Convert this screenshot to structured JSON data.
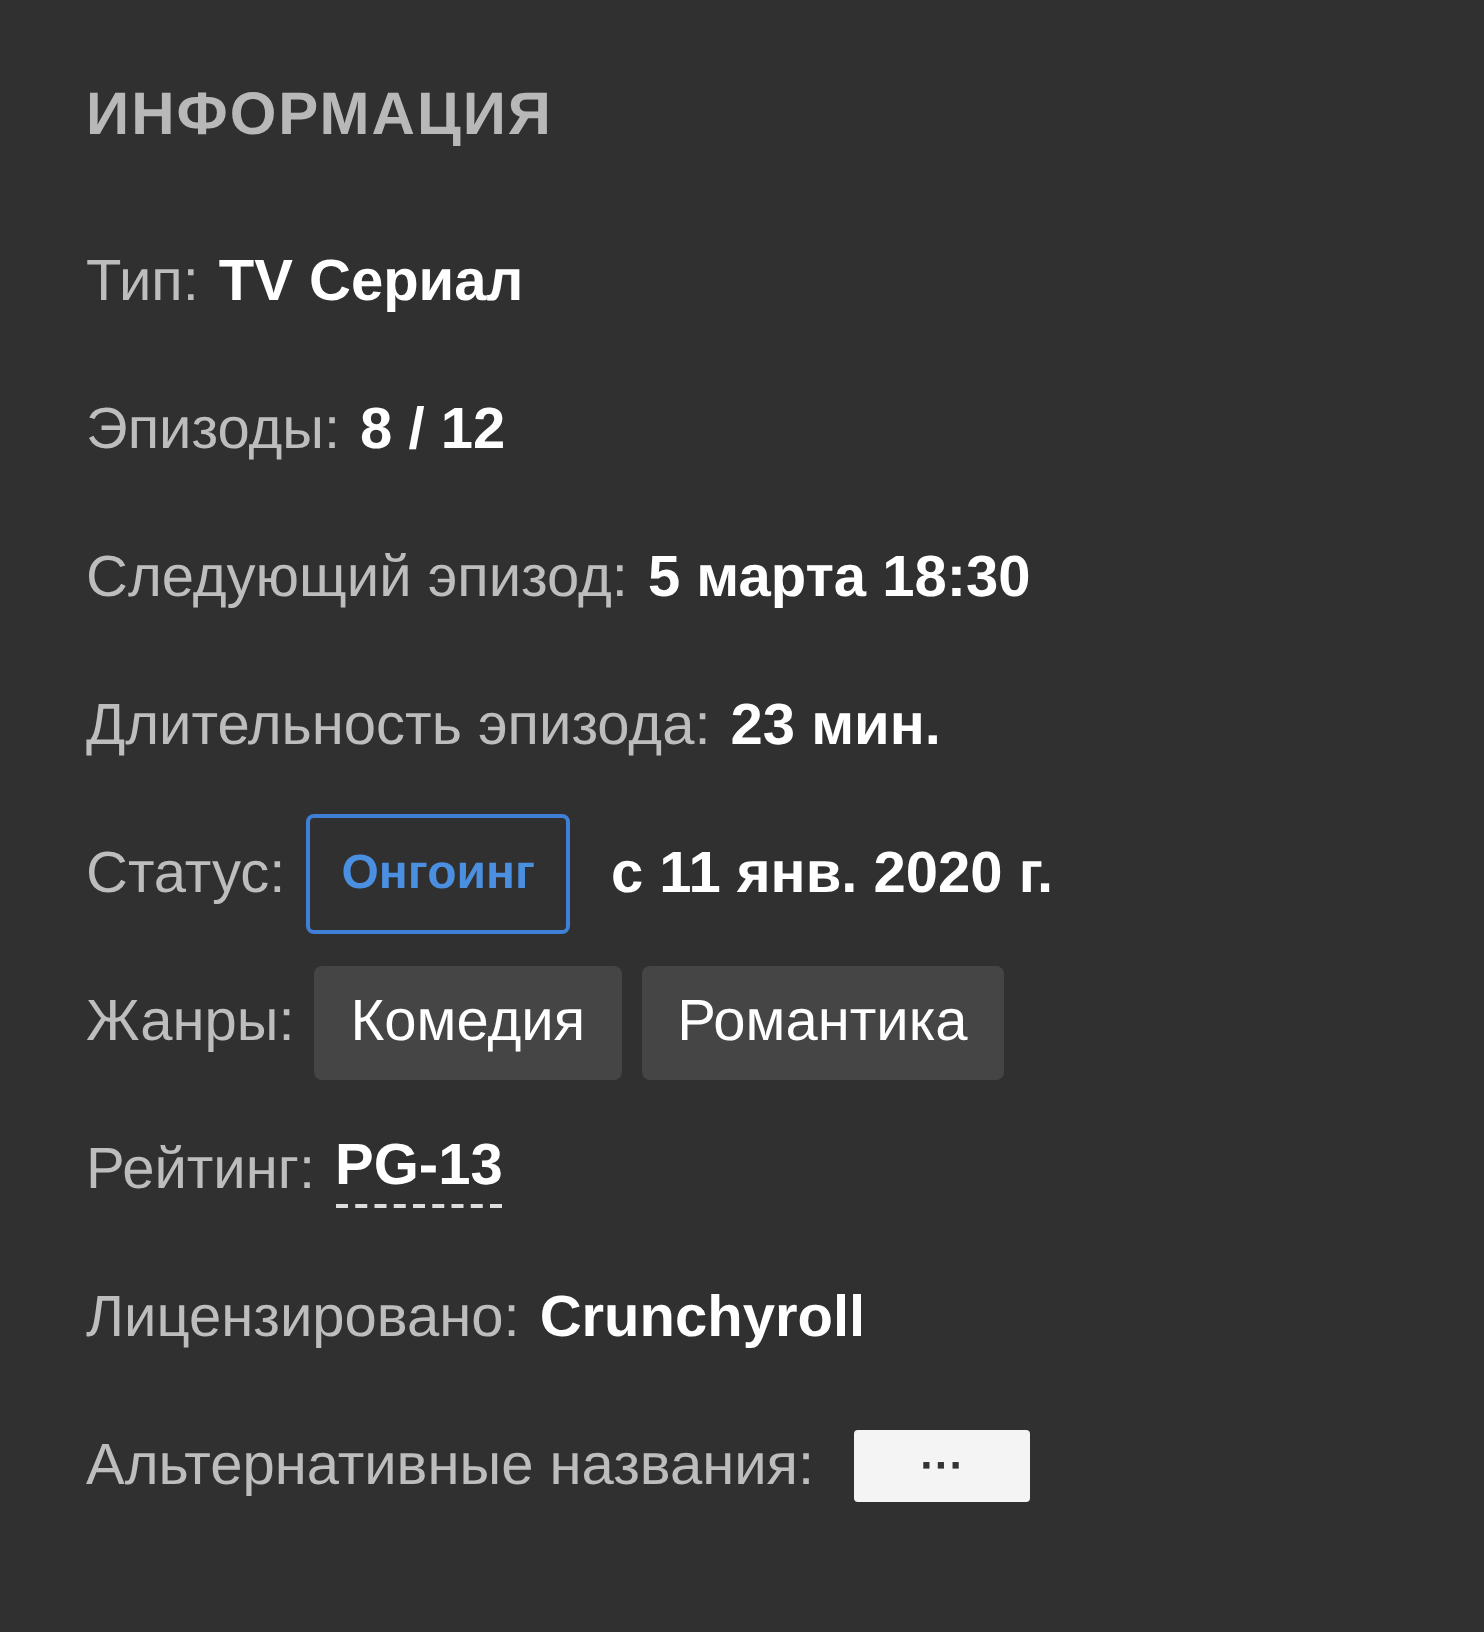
{
  "section": {
    "title": "ИНФОРМАЦИЯ"
  },
  "rows": [
    {
      "kind": "text",
      "label": "Тип:",
      "value": "TV Сериал"
    },
    {
      "kind": "text",
      "label": "Эпизоды:",
      "value": "8 / 12"
    },
    {
      "kind": "text",
      "label": "Следующий эпизод:",
      "value": "5 марта 18:30"
    },
    {
      "kind": "text",
      "label": "Длительность эпизода:",
      "value": "23 мин."
    },
    {
      "kind": "status",
      "label": "Статус:",
      "badge": "Онгоинг",
      "value": "с 11 янв. 2020 г."
    },
    {
      "kind": "tags",
      "label": "Жанры:",
      "tags": [
        "Комедия",
        "Романтика"
      ]
    },
    {
      "kind": "abbr",
      "label": "Рейтинг:",
      "value": "PG-13"
    },
    {
      "kind": "text",
      "label": "Лицензировано:",
      "value": "Crunchyroll"
    },
    {
      "kind": "more",
      "label": "Альтернативные названия:",
      "button": "···"
    }
  ]
}
